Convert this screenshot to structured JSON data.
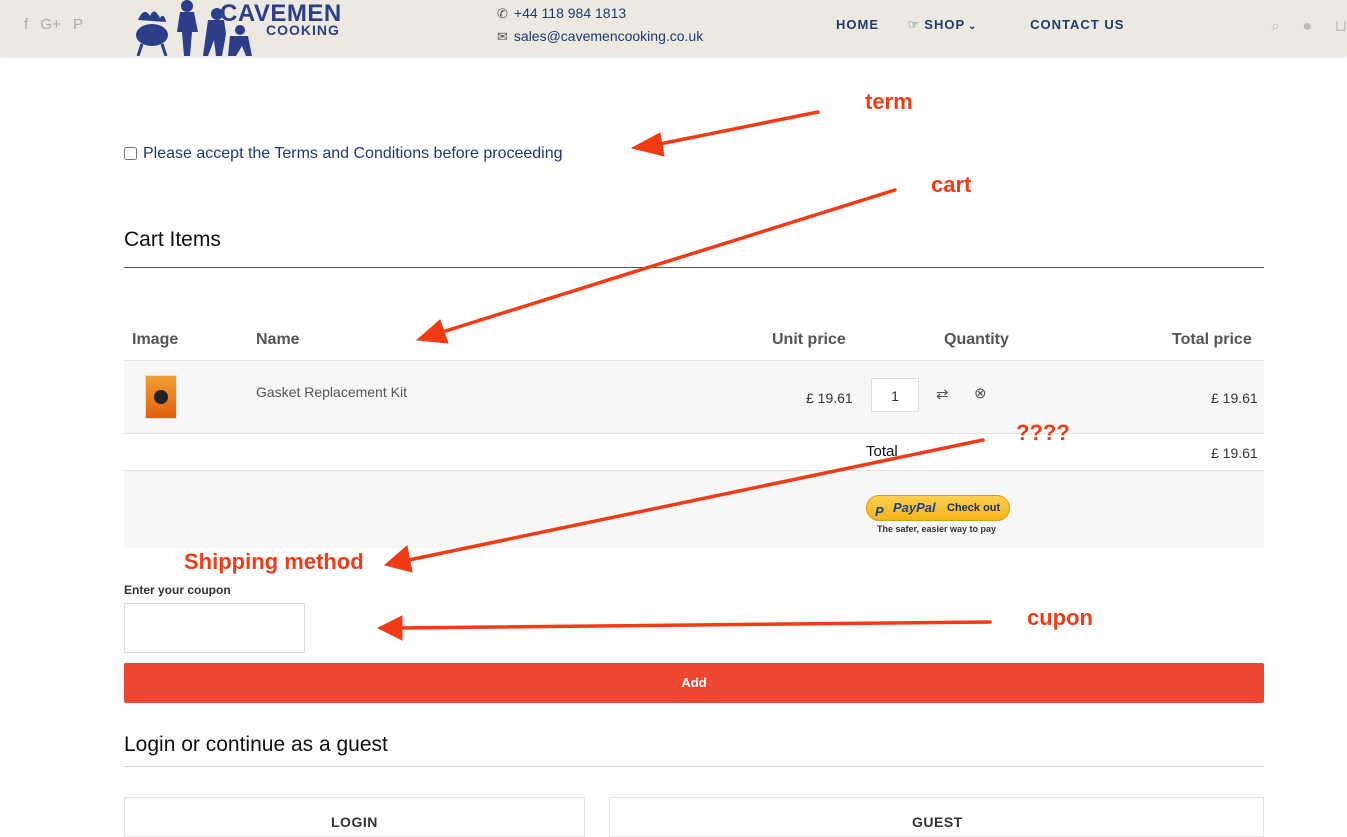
{
  "header": {
    "social": [
      "f",
      "G+",
      "P"
    ],
    "logo_line1": "CAVEMEN",
    "logo_line2": "COOKING",
    "phone": "+44 118 984 1813",
    "email": "sales@cavemencooking.co.uk",
    "nav": [
      "HOME",
      "SHOP",
      "CONTACT US"
    ]
  },
  "terms": {
    "label": "Please accept the Terms and Conditions before proceeding"
  },
  "cart": {
    "title": "Cart Items",
    "columns": [
      "Image",
      "Name",
      "Unit price",
      "Quantity",
      "Total price"
    ],
    "items": [
      {
        "name": "Gasket Replacement Kit",
        "unit_price": "£ 19.61",
        "quantity": "1",
        "total": "£ 19.61"
      }
    ],
    "total_label": "Total",
    "total_value": "£ 19.61"
  },
  "paypal": {
    "brand": "PayPal",
    "button_text": "Check out",
    "tagline": "The safer, easier way to pay"
  },
  "coupon": {
    "label": "Enter your coupon",
    "value": "",
    "button": "Add"
  },
  "login": {
    "title": "Login or continue as a guest",
    "login_tab": "LOGIN",
    "guest_tab": "GUEST"
  },
  "annotations": {
    "term": "term",
    "cart": "cart",
    "question": "????",
    "shipping": "Shipping method",
    "cupon": "cupon"
  },
  "colors": {
    "accent": "#ee4630",
    "brand": "#2c3d8a",
    "annotation": "#f23a15",
    "header_bg": "#ebe9e1"
  }
}
